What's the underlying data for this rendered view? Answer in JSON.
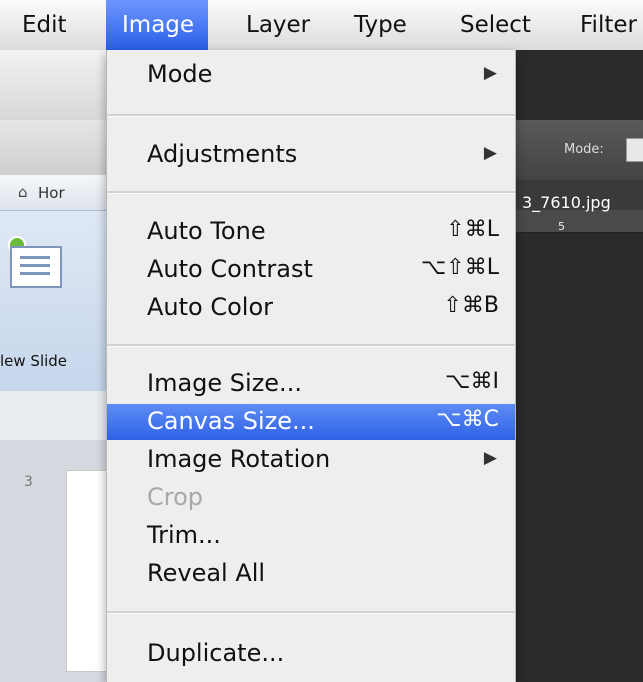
{
  "menubar": {
    "items": [
      {
        "label": "Edit"
      },
      {
        "label": "Image"
      },
      {
        "label": "Layer"
      },
      {
        "label": "Type"
      },
      {
        "label": "Select"
      },
      {
        "label": "Filter"
      }
    ]
  },
  "background_left": {
    "home_tab": "Hor",
    "new_slide_label": "lew Slide",
    "slide_number": "3"
  },
  "background_right": {
    "mode_label": "Mode:",
    "file_tab": "3_7610.jpg",
    "ruler_number": "5"
  },
  "menu": {
    "mode": "Mode",
    "adjustments": "Adjustments",
    "auto_tone": "Auto Tone",
    "auto_tone_shortcut": "⇧⌘L",
    "auto_contrast": "Auto Contrast",
    "auto_contrast_shortcut": "⌥⇧⌘L",
    "auto_color": "Auto Color",
    "auto_color_shortcut": "⇧⌘B",
    "image_size": "Image Size...",
    "image_size_shortcut": "⌥⌘I",
    "canvas_size": "Canvas Size...",
    "canvas_size_shortcut": "⌥⌘C",
    "image_rotation": "Image Rotation",
    "crop": "Crop",
    "trim": "Trim...",
    "reveal_all": "Reveal All",
    "duplicate": "Duplicate...",
    "submenu_arrow": "▶"
  },
  "icons": {
    "submenu": "triangle-right-icon",
    "home": "home-icon"
  },
  "colors": {
    "highlight": "#2e62e6",
    "menu_bg": "#eeeeee",
    "disabled_text": "#a8a8a8"
  }
}
